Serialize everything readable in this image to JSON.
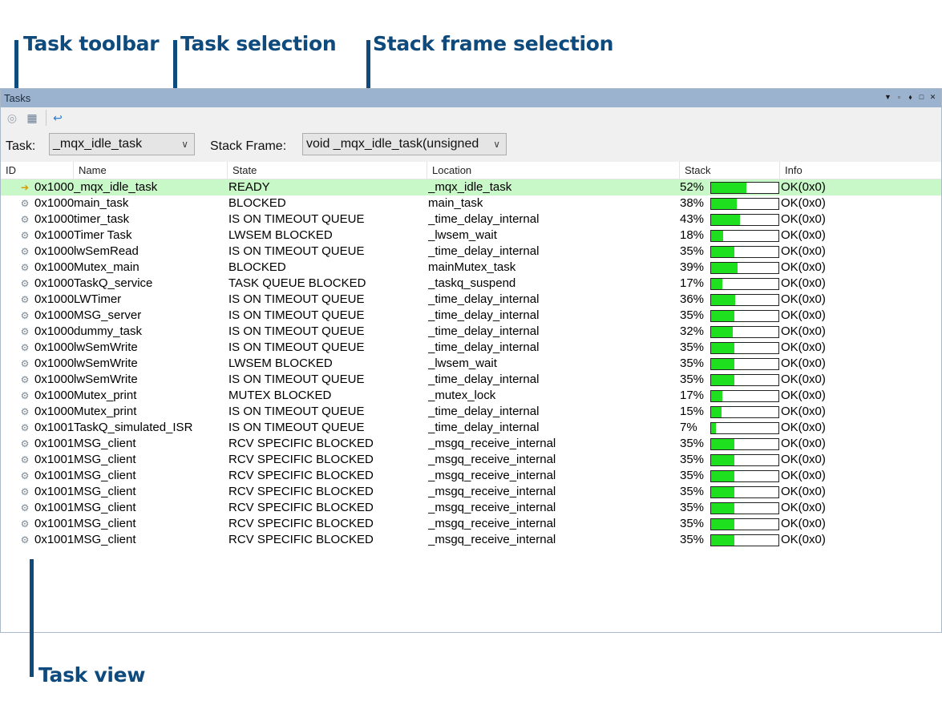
{
  "callouts": {
    "toolbar": "Task toolbar",
    "task_selection": "Task selection",
    "stack_selection": "Stack frame selection",
    "task_view": "Task view"
  },
  "colors": {
    "callout": "#0f4a7c",
    "titlebar": "#9cb3cf",
    "selected_row": "#c8f7c8",
    "stack_fill": "#1ee01e"
  },
  "panel": {
    "title": "Tasks",
    "title_controls": [
      "▼",
      "▫",
      "⬧",
      "□",
      "✕"
    ]
  },
  "toolbar": {
    "buttons": [
      {
        "icon": "stop-icon",
        "glyph": "◎"
      },
      {
        "icon": "properties-icon",
        "glyph": "▦"
      },
      {
        "icon": "refresh-icon",
        "glyph": "↩"
      }
    ]
  },
  "selection": {
    "task_label": "Task:",
    "task_value": "_mqx_idle_task",
    "stack_label": "Stack Frame:",
    "stack_value": "void _mqx_idle_task(unsigned"
  },
  "table": {
    "columns": [
      "ID",
      "Name",
      "State",
      "Location",
      "Stack",
      "Info"
    ],
    "rows": [
      {
        "id": "0x1000",
        "name": "_mqx_idle_task",
        "state": "READY",
        "location": "_mqx_idle_task",
        "stack": "52%",
        "stack_pct": 52,
        "info": "OK(0x0)",
        "selected": true
      },
      {
        "id": "0x1000",
        "name": "main_task",
        "state": "BLOCKED",
        "location": "main_task",
        "stack": "38%",
        "stack_pct": 38,
        "info": "OK(0x0)"
      },
      {
        "id": "0x1000",
        "name": "timer_task",
        "state": "IS ON TIMEOUT QUEUE",
        "location": "_time_delay_internal",
        "stack": "43%",
        "stack_pct": 43,
        "info": "OK(0x0)"
      },
      {
        "id": "0x1000",
        "name": "Timer Task",
        "state": "LWSEM BLOCKED",
        "location": "_lwsem_wait",
        "stack": "18%",
        "stack_pct": 18,
        "info": "OK(0x0)"
      },
      {
        "id": "0x1000",
        "name": "lwSemRead",
        "state": "IS ON TIMEOUT QUEUE",
        "location": "_time_delay_internal",
        "stack": "35%",
        "stack_pct": 35,
        "info": "OK(0x0)"
      },
      {
        "id": "0x1000",
        "name": "Mutex_main",
        "state": "BLOCKED",
        "location": "mainMutex_task",
        "stack": "39%",
        "stack_pct": 39,
        "info": "OK(0x0)"
      },
      {
        "id": "0x1000",
        "name": "TaskQ_service",
        "state": "TASK QUEUE BLOCKED",
        "location": "_taskq_suspend",
        "stack": "17%",
        "stack_pct": 17,
        "info": "OK(0x0)"
      },
      {
        "id": "0x1000",
        "name": "LWTimer",
        "state": "IS ON TIMEOUT QUEUE",
        "location": "_time_delay_internal",
        "stack": "36%",
        "stack_pct": 36,
        "info": "OK(0x0)"
      },
      {
        "id": "0x1000",
        "name": "MSG_server",
        "state": "IS ON TIMEOUT QUEUE",
        "location": "_time_delay_internal",
        "stack": "35%",
        "stack_pct": 35,
        "info": "OK(0x0)"
      },
      {
        "id": "0x1000",
        "name": "dummy_task",
        "state": "IS ON TIMEOUT QUEUE",
        "location": "_time_delay_internal",
        "stack": "32%",
        "stack_pct": 32,
        "info": "OK(0x0)"
      },
      {
        "id": "0x1000",
        "name": "lwSemWrite",
        "state": "IS ON TIMEOUT QUEUE",
        "location": "_time_delay_internal",
        "stack": "35%",
        "stack_pct": 35,
        "info": "OK(0x0)"
      },
      {
        "id": "0x1000",
        "name": "lwSemWrite",
        "state": "LWSEM BLOCKED",
        "location": "_lwsem_wait",
        "stack": "35%",
        "stack_pct": 35,
        "info": "OK(0x0)"
      },
      {
        "id": "0x1000",
        "name": "lwSemWrite",
        "state": "IS ON TIMEOUT QUEUE",
        "location": "_time_delay_internal",
        "stack": "35%",
        "stack_pct": 35,
        "info": "OK(0x0)"
      },
      {
        "id": "0x1000",
        "name": "Mutex_print",
        "state": "MUTEX BLOCKED",
        "location": "_mutex_lock",
        "stack": "17%",
        "stack_pct": 17,
        "info": "OK(0x0)"
      },
      {
        "id": "0x1000",
        "name": "Mutex_print",
        "state": "IS ON TIMEOUT QUEUE",
        "location": "_time_delay_internal",
        "stack": "15%",
        "stack_pct": 15,
        "info": "OK(0x0)"
      },
      {
        "id": "0x1001",
        "name": "TaskQ_simulated_ISR",
        "state": "IS ON TIMEOUT QUEUE",
        "location": "_time_delay_internal",
        "stack": "7%",
        "stack_pct": 7,
        "info": "OK(0x0)"
      },
      {
        "id": "0x1001",
        "name": "MSG_client",
        "state": "RCV SPECIFIC BLOCKED",
        "location": "_msgq_receive_internal",
        "stack": "35%",
        "stack_pct": 35,
        "info": "OK(0x0)"
      },
      {
        "id": "0x1001",
        "name": "MSG_client",
        "state": "RCV SPECIFIC BLOCKED",
        "location": "_msgq_receive_internal",
        "stack": "35%",
        "stack_pct": 35,
        "info": "OK(0x0)"
      },
      {
        "id": "0x1001",
        "name": "MSG_client",
        "state": "RCV SPECIFIC BLOCKED",
        "location": "_msgq_receive_internal",
        "stack": "35%",
        "stack_pct": 35,
        "info": "OK(0x0)"
      },
      {
        "id": "0x1001",
        "name": "MSG_client",
        "state": "RCV SPECIFIC BLOCKED",
        "location": "_msgq_receive_internal",
        "stack": "35%",
        "stack_pct": 35,
        "info": "OK(0x0)"
      },
      {
        "id": "0x1001",
        "name": "MSG_client",
        "state": "RCV SPECIFIC BLOCKED",
        "location": "_msgq_receive_internal",
        "stack": "35%",
        "stack_pct": 35,
        "info": "OK(0x0)"
      },
      {
        "id": "0x1001",
        "name": "MSG_client",
        "state": "RCV SPECIFIC BLOCKED",
        "location": "_msgq_receive_internal",
        "stack": "35%",
        "stack_pct": 35,
        "info": "OK(0x0)"
      },
      {
        "id": "0x1001",
        "name": "MSG_client",
        "state": "RCV SPECIFIC BLOCKED",
        "location": "_msgq_receive_internal",
        "stack": "35%",
        "stack_pct": 35,
        "info": "OK(0x0)"
      }
    ]
  }
}
